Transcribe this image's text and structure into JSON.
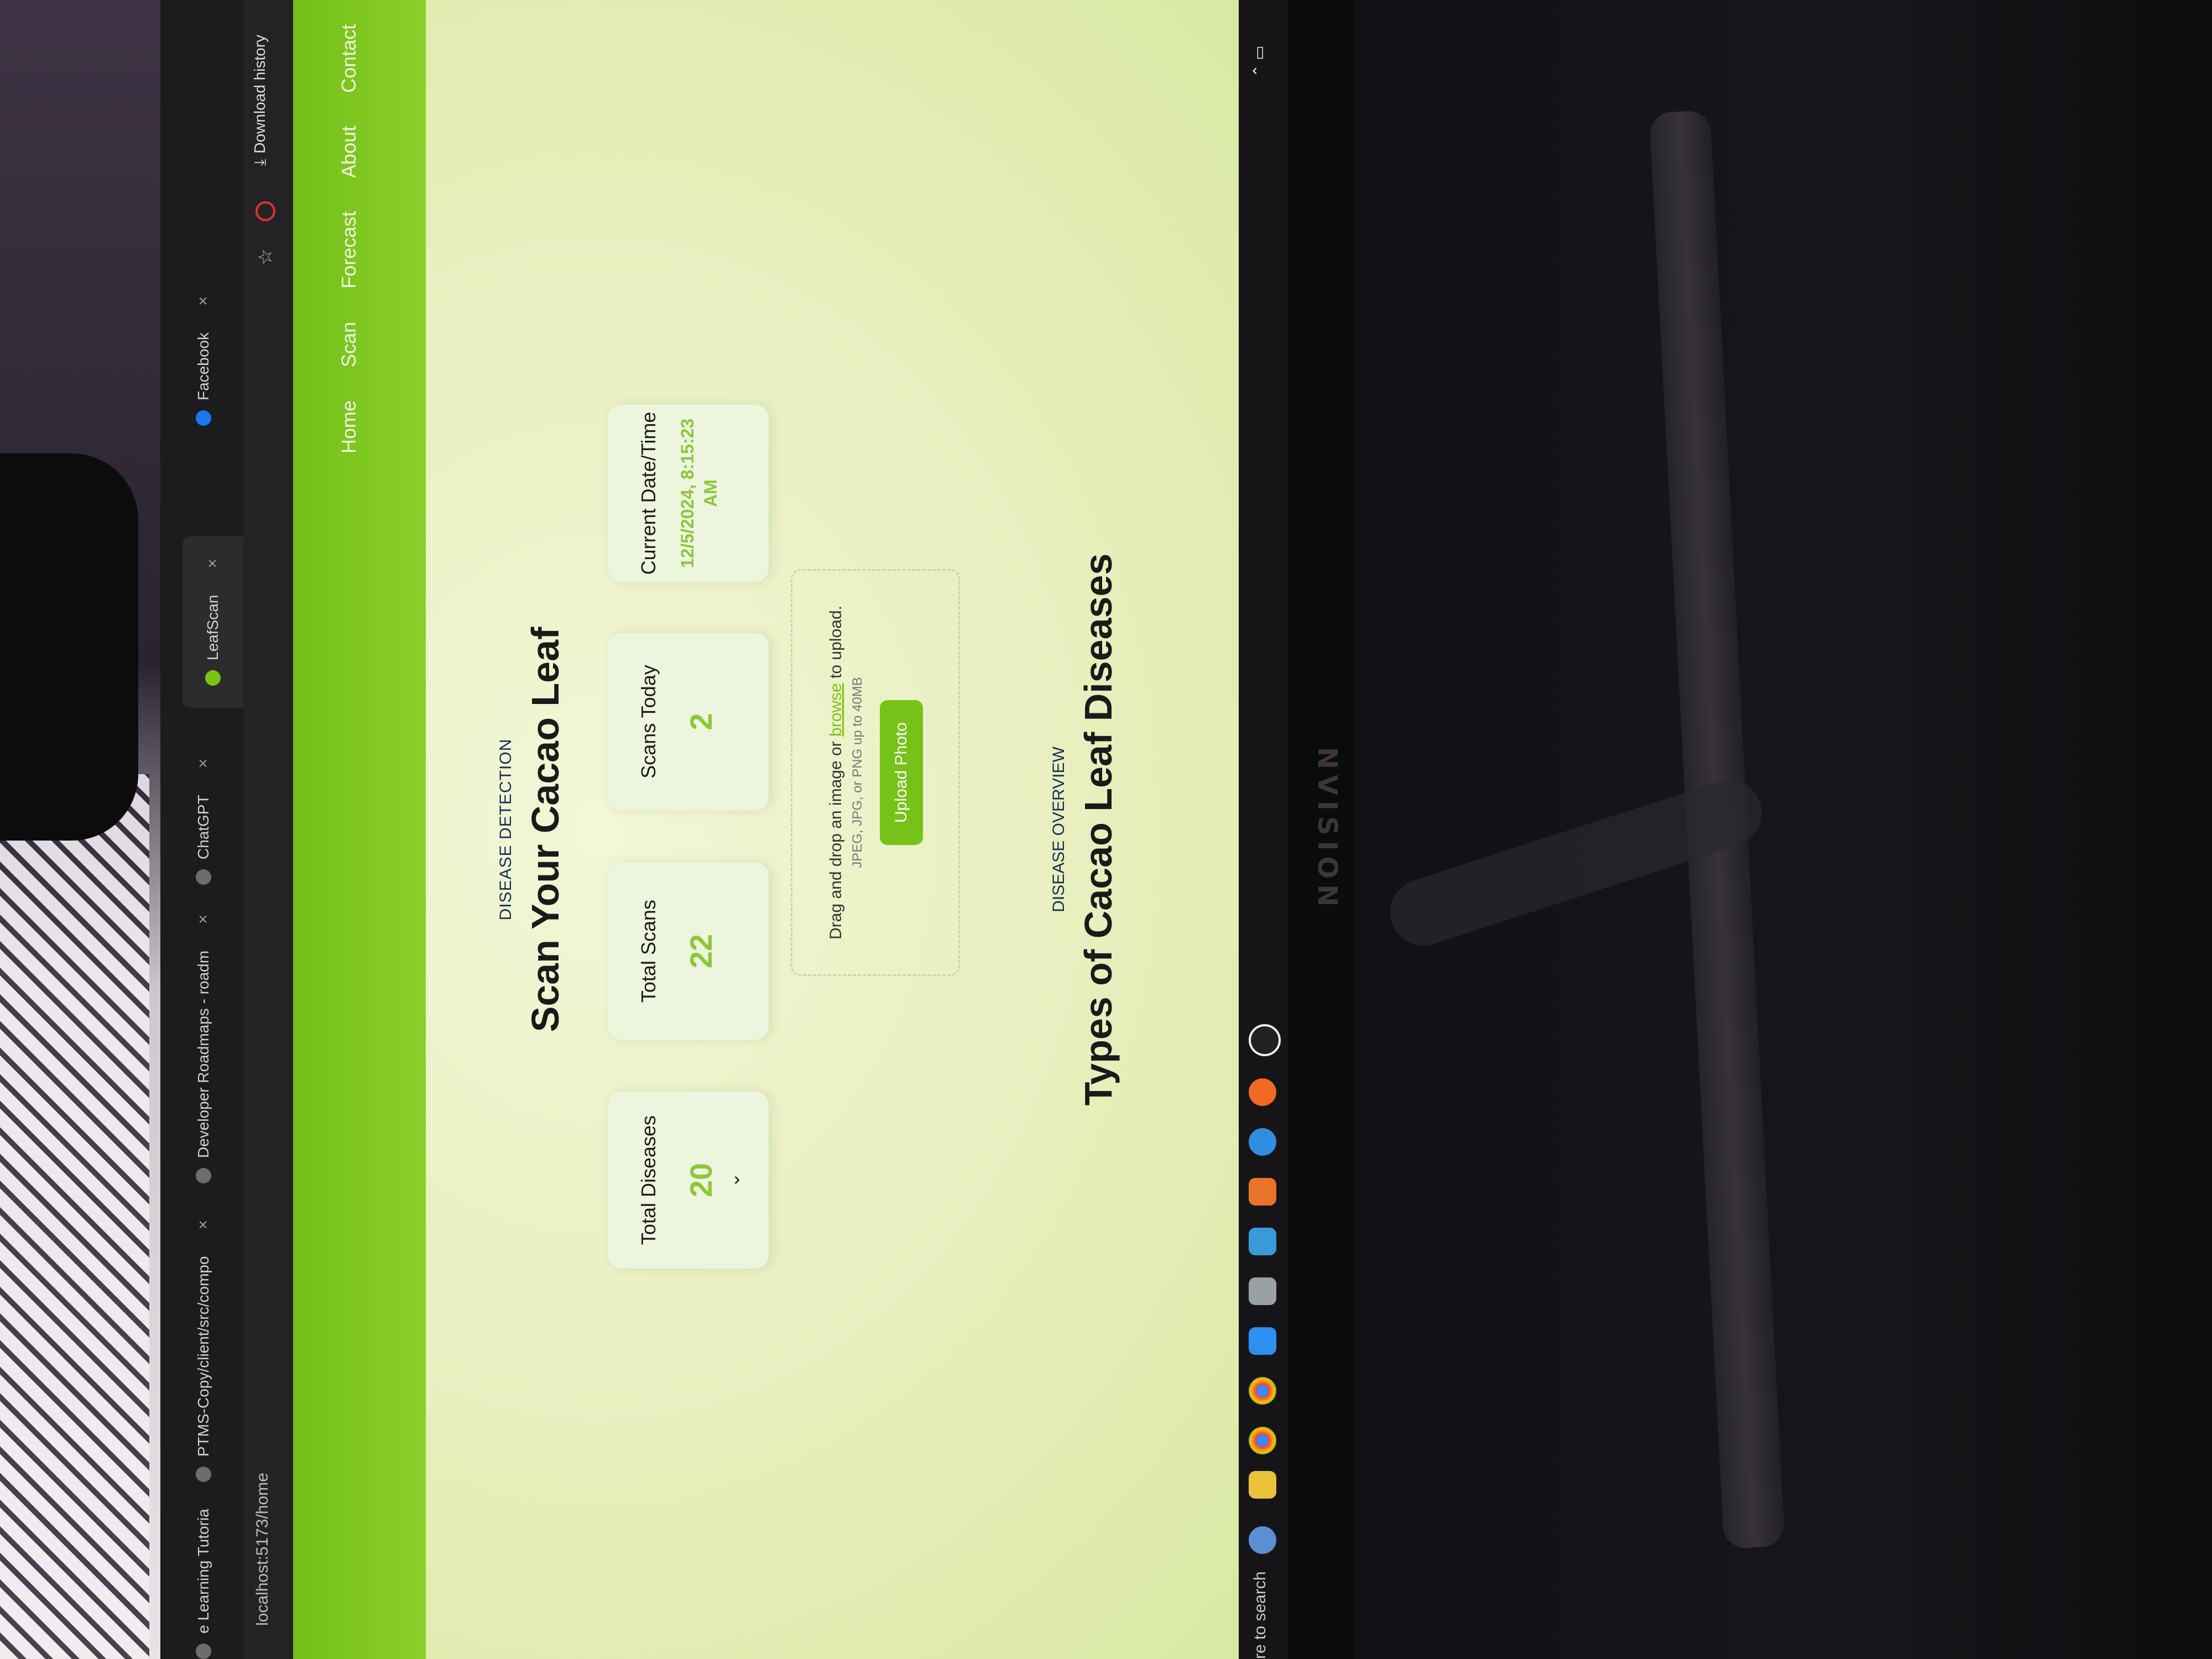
{
  "browser": {
    "tabs": [
      {
        "label": "e Learning Tutoria"
      },
      {
        "label": "PTMS-Copy/client/src/compo"
      },
      {
        "label": "Developer Roadmaps - roadm"
      },
      {
        "label": "ChatGPT"
      },
      {
        "label": "LeafScan"
      },
      {
        "label": "Facebook"
      }
    ],
    "url": "localhost:5173/home",
    "download_label": "Download history"
  },
  "nav": {
    "links": [
      "Home",
      "Scan",
      "Forecast",
      "About",
      "Contact"
    ]
  },
  "hero": {
    "eyebrow": "DISEASE DETECTION",
    "title": "Scan Your Cacao Leaf"
  },
  "stats": {
    "total_diseases_label": "Total Diseases",
    "total_diseases_value": "20",
    "total_scans_label": "Total Scans",
    "total_scans_value": "22",
    "scans_today_label": "Scans Today",
    "scans_today_value": "2",
    "datetime_label": "Current Date/Time",
    "datetime_value": "12/5/2024, 8:15:23 AM"
  },
  "upload": {
    "text_before": "Drag and drop an image or ",
    "link": "browse",
    "text_after": " to upload.",
    "hint": "JPEG, JPG, or PNG up to 40MB",
    "button": "Upload Photo"
  },
  "overview": {
    "eyebrow": "DISEASE OVERVIEW",
    "title": "Types of Cacao Leaf Diseases"
  },
  "taskbar": {
    "search": "re to search"
  },
  "monitor": {
    "brand": "NVISION"
  },
  "colors": {
    "accent": "#7cc414",
    "stat_value": "#8bc83a",
    "navbar": "#7cc41e"
  }
}
